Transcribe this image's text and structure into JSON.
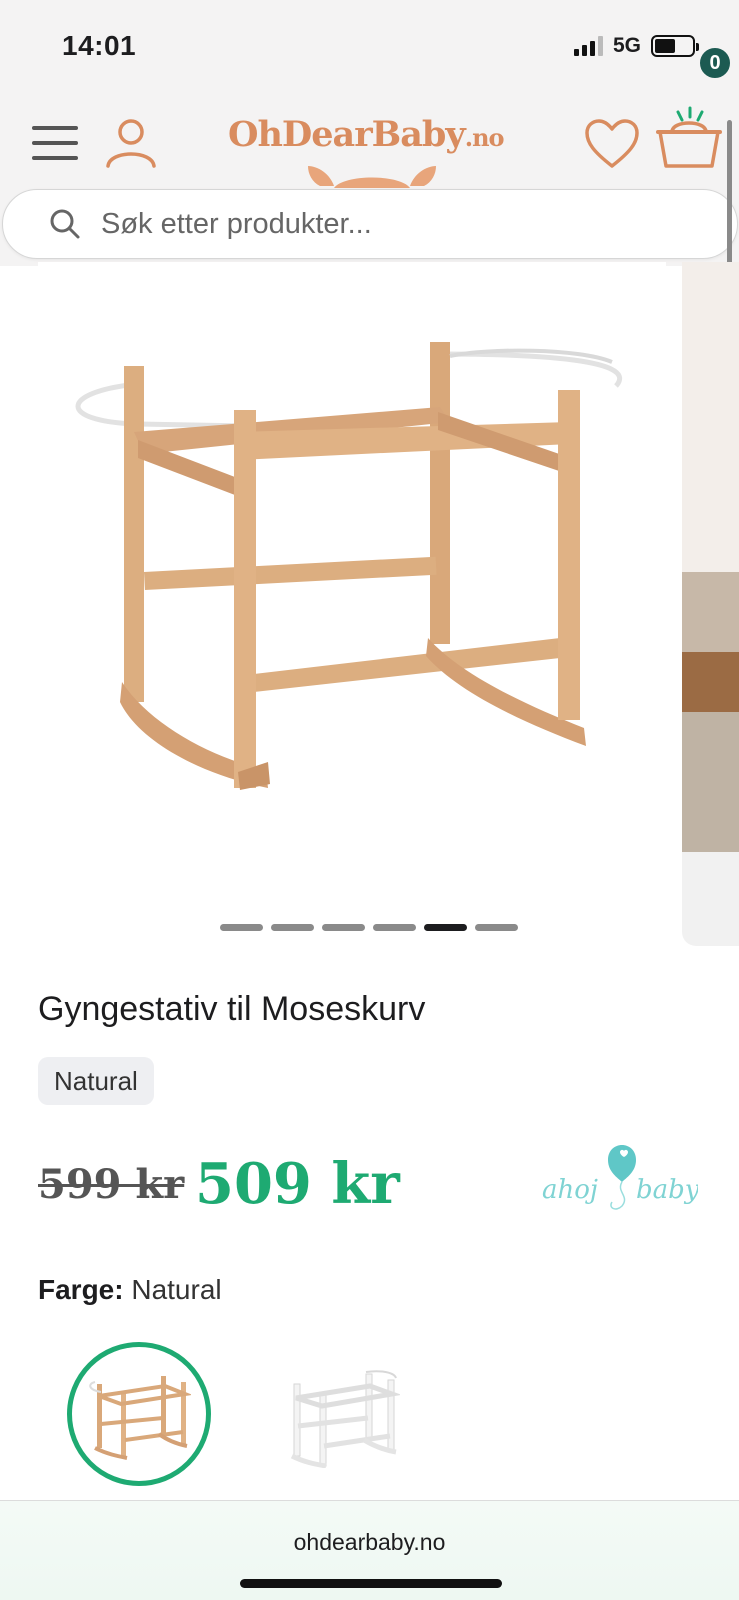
{
  "status": {
    "time": "14:01",
    "network": "5G"
  },
  "header": {
    "logo_main": "OhDearBaby",
    "logo_tld": ".no",
    "cart_count": "0",
    "icons": [
      "menu-icon",
      "user-icon",
      "heart-icon",
      "basket-icon"
    ]
  },
  "search": {
    "placeholder": "Søk etter produkter..."
  },
  "gallery": {
    "slide_count": 6,
    "active_index": 4
  },
  "product": {
    "title": "Gyngestativ til Moseskurv",
    "variant_chip": "Natural",
    "old_price": "599 kr",
    "new_price": "509 kr",
    "brand": "ahoj baby",
    "color_label": "Farge:",
    "color_value": "Natural",
    "swatches": [
      "Natural",
      "White"
    ]
  },
  "browser": {
    "url": "ohdearbaby.no"
  },
  "colors": {
    "accent_green": "#1eaa72",
    "brand_orange": "#d98c5f",
    "badge_teal": "#1c5a52",
    "brand_teal": "#5fc7c7"
  }
}
